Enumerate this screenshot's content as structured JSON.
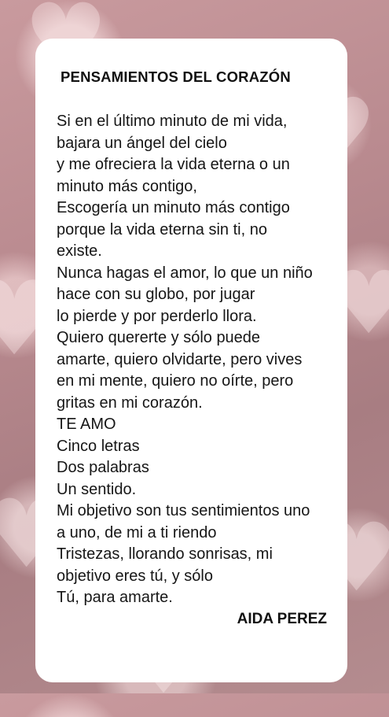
{
  "card": {
    "title": "PENSAMIENTOS DEL CORAZÓN",
    "lines": [
      "Si en el último minuto de mi vida,",
      "bajara un ángel del cielo",
      "y me ofreciera la vida eterna o un",
      "minuto más contigo,",
      "Escogería un minuto más contigo",
      "porque la vida eterna sin ti, no",
      "existe.",
      "Nunca hagas el amor, lo que un niño",
      "hace con su globo, por jugar",
      "lo pierde y por perderlo llora.",
      "Quiero quererte y sólo puede",
      "amarte, quiero olvidarte, pero vives",
      "en mi mente, quiero no oírte, pero",
      "gritas en mi corazón.",
      "TE AMO",
      "Cinco letras",
      "Dos palabras",
      "Un sentido.",
      "Mi objetivo son tus sentimientos uno",
      "a uno, de mi a ti riendo",
      "Tristezas, llorando sonrisas, mi",
      "objetivo eres tú, y sólo",
      "Tú, para amarte."
    ],
    "author": "AIDA PEREZ"
  },
  "background": {
    "style": "blurred pink bokeh hearts",
    "colors": [
      "#c99a9e",
      "#a87d82",
      "#fff0f0"
    ],
    "icon": "heart-icon"
  }
}
